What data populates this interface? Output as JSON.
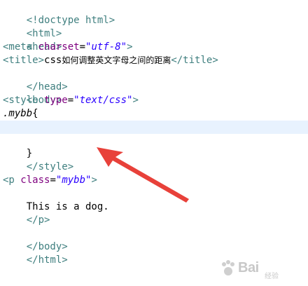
{
  "colors": {
    "tag": "#3f7f7f",
    "attribute": "#7f007f",
    "string": "#2a00ff",
    "text": "#000000",
    "current_line": "#e8f2fe",
    "arrow": "#e8413a"
  },
  "code": {
    "l1": {
      "tag": "<!doctype html>"
    },
    "l2": {
      "tag": "<html>"
    },
    "l3": {
      "tag": "<head>"
    },
    "l4": {
      "open": "<meta",
      "attr": "charset",
      "eq": "=",
      "val": "\"utf-8\"",
      "close": ">"
    },
    "l5": {
      "open": "<title>",
      "text": "css",
      "cjk": "如何调整英文字母之间的距离",
      "close": "</title>"
    },
    "l6": {
      "tag": "</head>"
    },
    "l7": {
      "tag": "<body>"
    },
    "l8": {
      "open": "<style",
      "attr": "type",
      "eq": "=",
      "val": "\"text/css\"",
      "close": ">"
    },
    "l9": {
      "selector": ".mybb",
      "brace": "{"
    },
    "l10": {
      "text": ""
    },
    "l11": {
      "text": "}"
    },
    "l12": {
      "tag": "</style>"
    },
    "l13": {
      "text": ""
    },
    "l14": {
      "open": "<p",
      "attr": "class",
      "eq": "=",
      "val": "\"mybb\"",
      "close": ">"
    },
    "l15": {
      "text": "This is a dog."
    },
    "l16": {
      "tag": "</p>"
    },
    "l17": {
      "text": ""
    },
    "l18": {
      "tag": "</body>"
    },
    "l19": {
      "tag": "</html>"
    }
  },
  "watermark": {
    "brand": "Bai",
    "sub": "经验"
  }
}
